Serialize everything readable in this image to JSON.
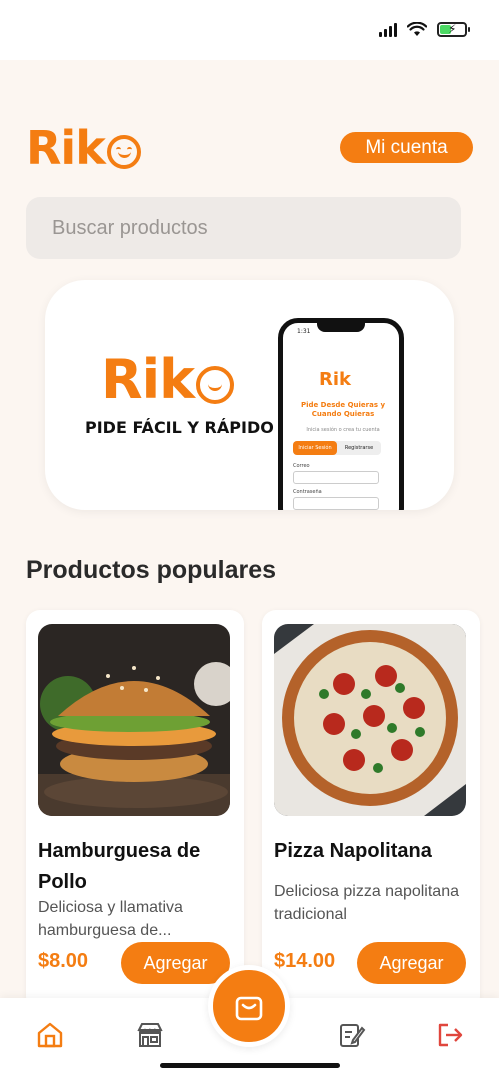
{
  "app": {
    "logo_text": "Rik",
    "account_button": "Mi cuenta"
  },
  "search": {
    "placeholder": "Buscar productos"
  },
  "banner": {
    "logo_text": "Rik",
    "tagline": "PIDE FÁCIL Y RÁPIDO",
    "phone": {
      "time": "1:31",
      "logo_text": "Rik",
      "title": "Pide Desde Quieras y Cuando Quieras",
      "subtitle": "Inicia sesión o crea tu cuenta",
      "tab_login": "Iniciar Sesión",
      "tab_register": "Registrarse",
      "email_label": "Correo",
      "password_label": "Contraseña"
    }
  },
  "section": {
    "title": "Productos populares"
  },
  "products": [
    {
      "name": "Hamburguesa de Pollo",
      "description": "Deliciosa y llamativa hamburguesa de...",
      "price": "$8.00",
      "button": "Agregar"
    },
    {
      "name": "Pizza Napolitana",
      "description": "Deliciosa pizza napolitana tradicional",
      "price": "$14.00",
      "button": "Agregar"
    }
  ],
  "nav": {
    "items": [
      "home-icon",
      "store-icon",
      "cart-icon",
      "orders-icon",
      "logout-icon"
    ]
  },
  "colors": {
    "accent": "#f47d12",
    "background": "#fcf6f1",
    "logout": "#e0463d"
  }
}
